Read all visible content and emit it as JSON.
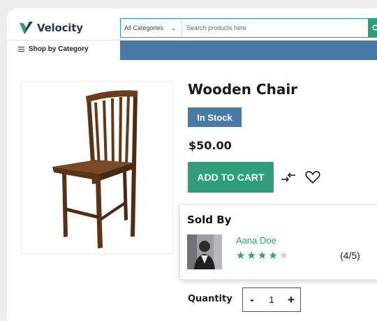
{
  "brand": {
    "name": "Velocity"
  },
  "search": {
    "category": "All Categories",
    "placeholder": "Search products here"
  },
  "nav": {
    "shop_by_category": "Shop by Category"
  },
  "product": {
    "title": "Wooden Chair",
    "stock_badge": "In Stock",
    "price": "$50.00",
    "add_to_cart": "ADD TO CART"
  },
  "seller": {
    "heading": "Sold By",
    "name": "Aana Doe",
    "rating_text": "(4/5)",
    "rating_value": 4,
    "rating_max": 5
  },
  "quantity": {
    "label": "Quantity",
    "value": "1",
    "minus": "-",
    "plus": "+"
  },
  "colors": {
    "accent_green": "#2e9e7a",
    "accent_blue": "#4a79a5",
    "star_off": "#cfcfcf"
  }
}
